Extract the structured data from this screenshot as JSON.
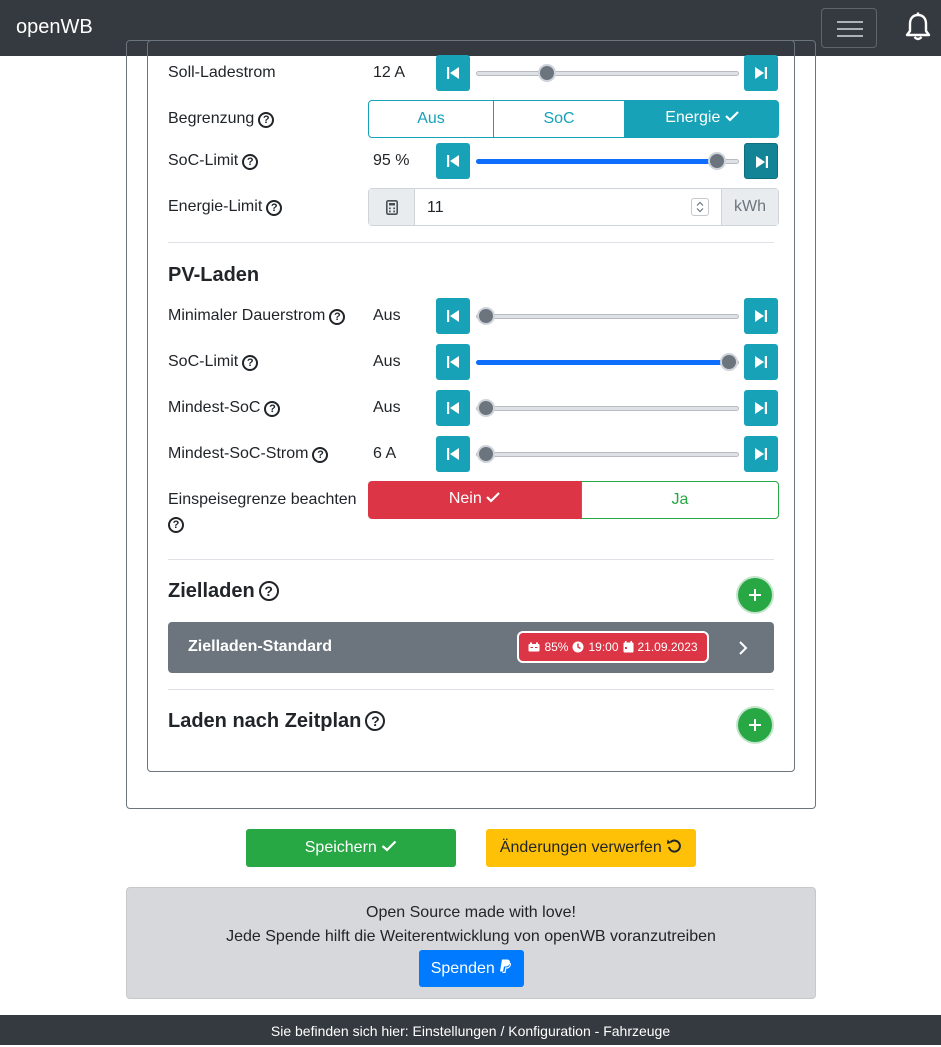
{
  "app": {
    "title": "openWB"
  },
  "sofort": {
    "soll_ladestrom": {
      "label": "Soll-Ladestrom",
      "value": "12 A",
      "level": 0.25
    },
    "begrenzung": {
      "label": "Begrenzung",
      "options": [
        "Aus",
        "SoC",
        "Energie"
      ],
      "selected": "Energie"
    },
    "soc_limit": {
      "label": "SoC-Limit",
      "value": "95 %",
      "level": 0.95
    },
    "energie_limit": {
      "label": "Energie-Limit",
      "value": "11",
      "unit": "kWh"
    }
  },
  "pv": {
    "heading": "PV-Laden",
    "min_dauerstrom": {
      "label": "Minimaler Dauerstrom",
      "value": "Aus",
      "level": 0
    },
    "soc_limit": {
      "label": "SoC-Limit",
      "value": "Aus",
      "level": 1
    },
    "mindest_soc": {
      "label": "Mindest-SoC",
      "value": "Aus",
      "level": 0
    },
    "mindest_soc_strom": {
      "label": "Mindest-SoC-Strom",
      "value": "6 A",
      "level": 0
    },
    "einspeisegrenze": {
      "label": "Einspeisegrenze beachten",
      "options": [
        "Nein",
        "Ja"
      ],
      "selected": "Nein"
    }
  },
  "zielladen": {
    "heading": "Zielladen",
    "plan": {
      "title": "Zielladen-Standard",
      "soc": "85%",
      "time": "19:00",
      "date": "21.09.2023"
    }
  },
  "zeitplan": {
    "heading": "Laden nach Zeitplan"
  },
  "actions": {
    "save": "Speichern",
    "discard": "Änderungen verwerfen"
  },
  "donate": {
    "line1": "Open Source made with love!",
    "line2": "Jede Spende hilft die Weiterentwicklung von openWB voranzutreiben",
    "button": "Spenden"
  },
  "footer": {
    "text": "Sie befinden sich hier: Einstellungen / Konfiguration - Fahrzeuge"
  },
  "colors": {
    "info": "#17a2b8",
    "success": "#28a745",
    "danger": "#dc3545",
    "warning": "#ffc107",
    "primary": "#007bff",
    "navbar": "#343a40"
  }
}
